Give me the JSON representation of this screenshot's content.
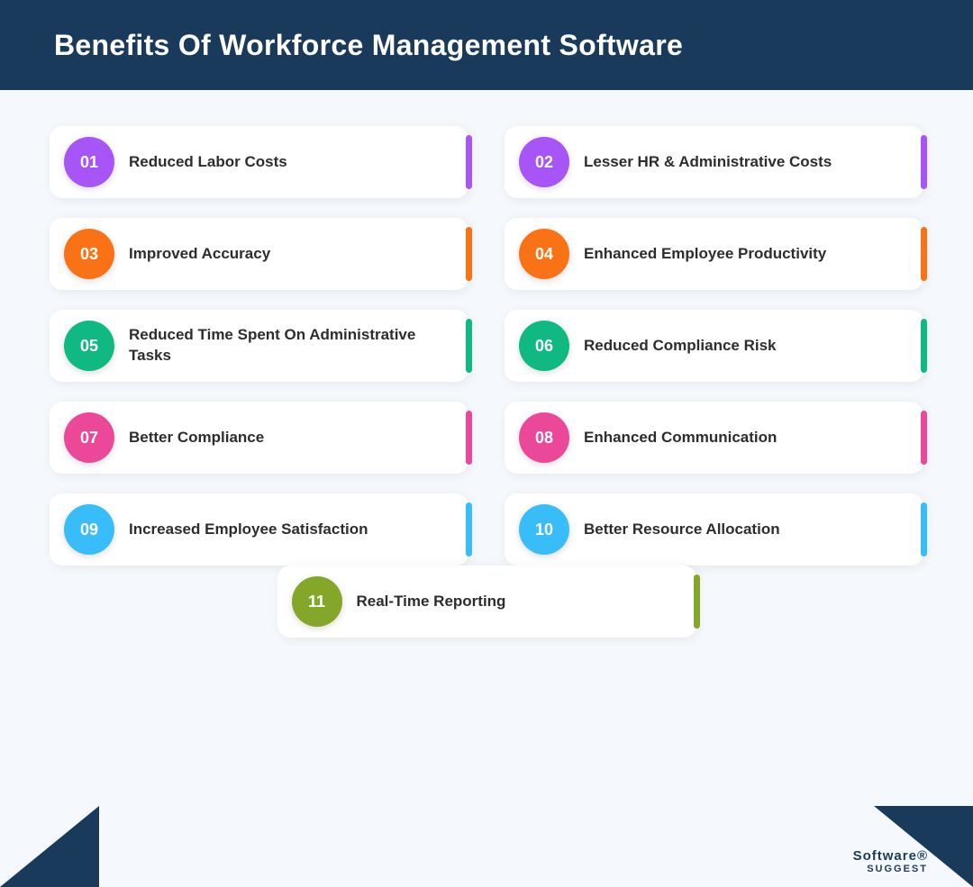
{
  "header": {
    "title": "Benefits Of Workforce Management Software"
  },
  "benefits": [
    {
      "id": "01",
      "text": "Reduced Labor Costs",
      "badge_color": "#a855f7",
      "accent_color": "#a855f7"
    },
    {
      "id": "02",
      "text": "Lesser HR & Administrative Costs",
      "badge_color": "#a855f7",
      "accent_color": "#a855f7"
    },
    {
      "id": "03",
      "text": "Improved Accuracy",
      "badge_color": "#f97316",
      "accent_color": "#f97316"
    },
    {
      "id": "04",
      "text": "Enhanced Employee Productivity",
      "badge_color": "#f97316",
      "accent_color": "#f97316"
    },
    {
      "id": "05",
      "text": "Reduced Time Spent On Administrative Tasks",
      "badge_color": "#10b981",
      "accent_color": "#10b981"
    },
    {
      "id": "06",
      "text": "Reduced Compliance Risk",
      "badge_color": "#10b981",
      "accent_color": "#10b981"
    },
    {
      "id": "07",
      "text": "Better Compliance",
      "badge_color": "#ec4899",
      "accent_color": "#ec4899"
    },
    {
      "id": "08",
      "text": "Enhanced Communication",
      "badge_color": "#ec4899",
      "accent_color": "#ec4899"
    },
    {
      "id": "09",
      "text": "Increased Employee Satisfaction",
      "badge_color": "#38bdf8",
      "accent_color": "#38bdf8"
    },
    {
      "id": "10",
      "text": "Better Resource Allocation",
      "badge_color": "#38bdf8",
      "accent_color": "#38bdf8"
    },
    {
      "id": "11",
      "text": "Real-Time Reporting",
      "badge_color": "#84a729",
      "accent_color": "#84a729"
    }
  ],
  "brand": {
    "line1": "Software®",
    "line2": "SUGGEST"
  }
}
